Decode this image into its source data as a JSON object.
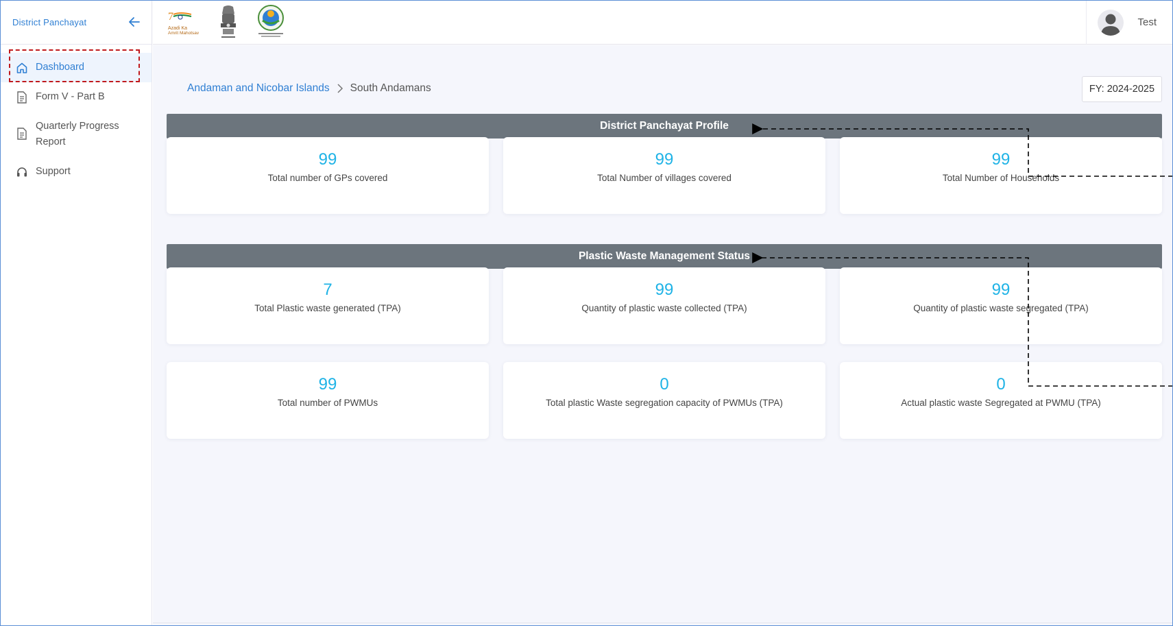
{
  "sidebar": {
    "title": "District Panchayat",
    "items": [
      {
        "label": "Dashboard",
        "icon": "home-icon",
        "active": true
      },
      {
        "label": "Form V - Part B",
        "icon": "document-icon"
      },
      {
        "label": "Quarterly Progress Report",
        "icon": "document-icon"
      },
      {
        "label": "Support",
        "icon": "headset-icon"
      }
    ]
  },
  "header": {
    "logos": [
      "azadi-ka-amrit-mahotsav-logo",
      "national-emblem-logo",
      "ministry-logo"
    ],
    "user": {
      "name": "Test"
    }
  },
  "breadcrumb": {
    "state": "Andaman and Nicobar Islands",
    "district": "South Andamans"
  },
  "fy": "FY: 2024-2025",
  "sections": {
    "profile": {
      "title": "District Panchayat Profile",
      "cards": [
        {
          "value": "99",
          "label": "Total number of GPs covered"
        },
        {
          "value": "99",
          "label": "Total Number of villages covered"
        },
        {
          "value": "99",
          "label": "Total Number of Households"
        }
      ]
    },
    "plastic": {
      "title": "Plastic Waste Management Status",
      "cards": [
        {
          "value": "7",
          "label": "Total Plastic waste generated (TPA)"
        },
        {
          "value": "99",
          "label": "Quantity of plastic waste collected (TPA)"
        },
        {
          "value": "99",
          "label": "Quantity of plastic waste segregated (TPA)"
        },
        {
          "value": "99",
          "label": "Total number of PWMUs"
        },
        {
          "value": "0",
          "label": "Total plastic Waste segregation capacity of PWMUs (TPA)"
        },
        {
          "value": "0",
          "label": "Actual plastic waste Segregated at PWMU (TPA)"
        }
      ]
    }
  },
  "colors": {
    "accent": "#2f7fd3",
    "value": "#1fb3e6",
    "section_bar": "#6c757d",
    "highlight": "#c0191c"
  }
}
